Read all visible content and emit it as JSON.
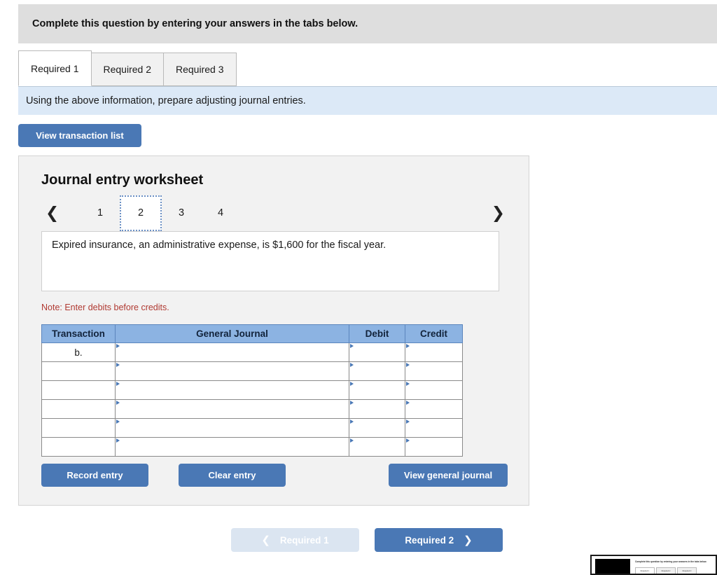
{
  "banner": {
    "text": "Complete this question by entering your answers in the tabs below."
  },
  "tabs": [
    {
      "label": "Required 1",
      "active": true
    },
    {
      "label": "Required 2",
      "active": false
    },
    {
      "label": "Required 3",
      "active": false
    }
  ],
  "sub_instruction": {
    "text": "Using the above information, prepare adjusting journal entries."
  },
  "toolbar": {
    "view_transaction_list_label": "View transaction list"
  },
  "worksheet": {
    "title": "Journal entry worksheet",
    "pager": {
      "prev_icon": "chevron-left-icon",
      "next_icon": "chevron-right-icon",
      "pages": [
        "1",
        "2",
        "3",
        "4"
      ],
      "current_page": "2"
    },
    "description": "Expired insurance, an administrative expense, is $1,600 for the fiscal year.",
    "note": "Note: Enter debits before credits.",
    "table": {
      "headers": [
        "Transaction",
        "General Journal",
        "Debit",
        "Credit"
      ],
      "rows": [
        {
          "transaction": "b.",
          "general_journal": "",
          "debit": "",
          "credit": ""
        },
        {
          "transaction": "",
          "general_journal": "",
          "debit": "",
          "credit": ""
        },
        {
          "transaction": "",
          "general_journal": "",
          "debit": "",
          "credit": ""
        },
        {
          "transaction": "",
          "general_journal": "",
          "debit": "",
          "credit": ""
        },
        {
          "transaction": "",
          "general_journal": "",
          "debit": "",
          "credit": ""
        },
        {
          "transaction": "",
          "general_journal": "",
          "debit": "",
          "credit": ""
        }
      ]
    },
    "actions": {
      "record_entry_label": "Record entry",
      "clear_entry_label": "Clear entry",
      "view_general_journal_label": "View general journal"
    }
  },
  "bottom_nav": {
    "prev_label": "Required 1",
    "next_label": "Required 2",
    "prev_icon": "chevron-left-icon",
    "next_icon": "chevron-right-icon"
  },
  "pip_preview": {
    "mini_title": "Complete this question by entering your answers in the tabs below.",
    "mini_tabs": [
      "Required 1",
      "Required 2",
      "Required 3"
    ]
  },
  "colors": {
    "accent_blue": "#4a78b5",
    "table_header_blue": "#8cb3e2",
    "banner_gray": "#dedede",
    "sub_instruction_blue": "#dce9f7",
    "note_red": "#b03a32",
    "panel_gray": "#f2f2f2",
    "nav_disabled_blue": "#dbe5f1"
  }
}
